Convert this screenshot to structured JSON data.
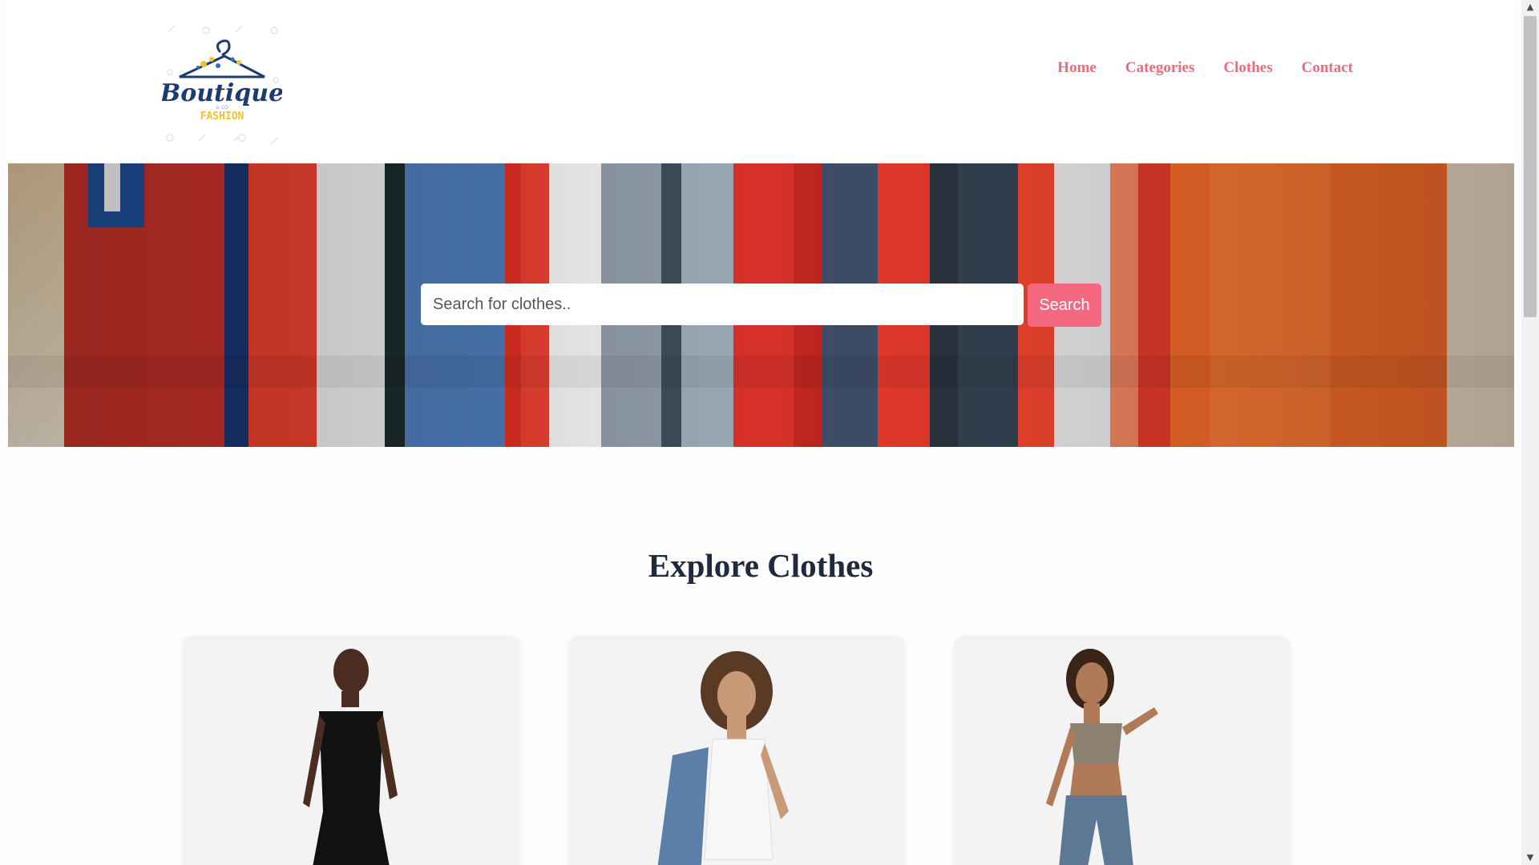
{
  "progress": {
    "fraction": 0.2
  },
  "header": {
    "logo": {
      "main": "Boutique",
      "sub": "FASHION",
      "tiny": "& CO",
      "icon": "hanger-icon"
    },
    "nav": [
      {
        "label": "Home"
      },
      {
        "label": "Categories"
      },
      {
        "label": "Clothes"
      },
      {
        "label": "Contact"
      }
    ]
  },
  "hero": {
    "search_placeholder": "Search for clothes..",
    "search_value": "",
    "search_button": "Search"
  },
  "section": {
    "title": "Explore Clothes"
  },
  "cards": [
    {
      "image": "model-black-halter-dress"
    },
    {
      "image": "model-white-tank-denim-jacket"
    },
    {
      "image": "model-metallic-crop-top-jeans"
    }
  ],
  "colors": {
    "accent": "#f4697f",
    "nav_text": "#ee6a7e",
    "title_text": "#1f2a3d",
    "logo_navy": "#1d3b6e",
    "logo_yellow": "#f2c12e"
  },
  "scrollbar": {
    "position_fraction": 0.0
  }
}
